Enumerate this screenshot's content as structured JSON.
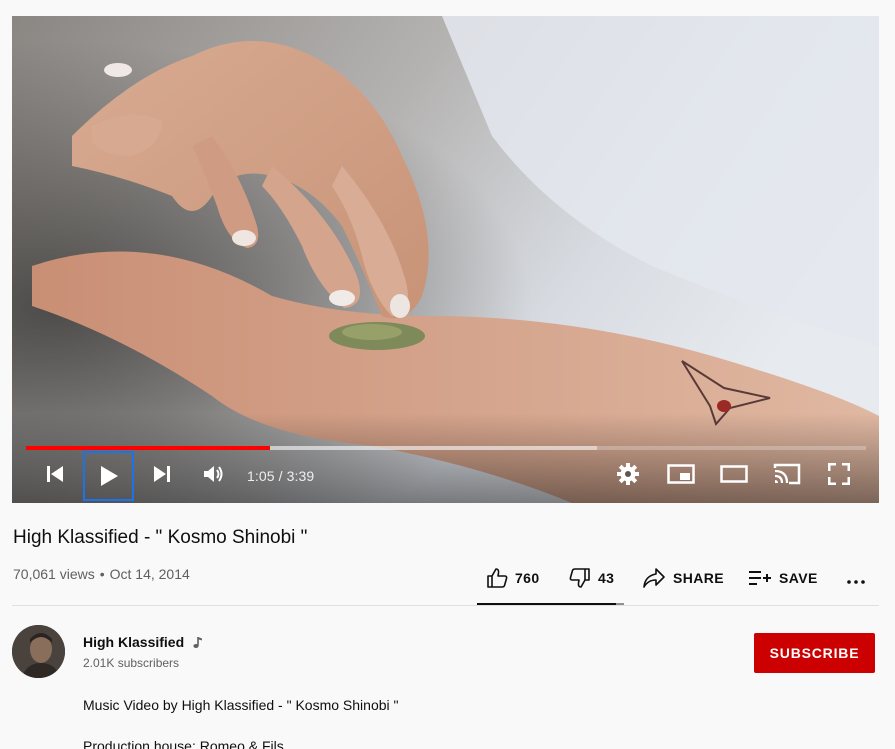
{
  "player": {
    "current_time": "1:05",
    "duration": "3:39",
    "time_display": "1:05 / 3:39",
    "played_fraction": 0.29,
    "buffered_fraction": 0.68
  },
  "video": {
    "title": "High Klassified - \" Kosmo Shinobi \"",
    "views": "70,061 views",
    "separator": "•",
    "date": "Oct 14, 2014"
  },
  "actions": {
    "like_count": "760",
    "dislike_count": "43",
    "share_label": "SHARE",
    "save_label": "SAVE",
    "like_fraction": 0.946
  },
  "channel": {
    "name": "High Klassified",
    "subscribers": "2.01K subscribers",
    "subscribe_label": "SUBSCRIBE"
  },
  "description": {
    "line1": "Music Video by High Klassified - \" Kosmo Shinobi \"",
    "line2": "Production house: Romeo & Fils"
  },
  "colors": {
    "progress_played": "#ff0000",
    "subscribe_bg": "#cc0000",
    "focus_ring": "#1a73e8"
  },
  "icons": {
    "prev": "previous-icon",
    "play": "play-icon",
    "next": "next-icon",
    "volume": "volume-icon",
    "settings": "gear-icon",
    "miniplayer": "miniplayer-icon",
    "theater": "theater-mode-icon",
    "cast": "cast-icon",
    "fullscreen": "fullscreen-icon",
    "like": "thumbs-up-icon",
    "dislike": "thumbs-down-icon",
    "share": "share-arrow-icon",
    "save": "playlist-add-icon",
    "more": "more-horizontal-icon",
    "artist": "music-note-icon"
  }
}
